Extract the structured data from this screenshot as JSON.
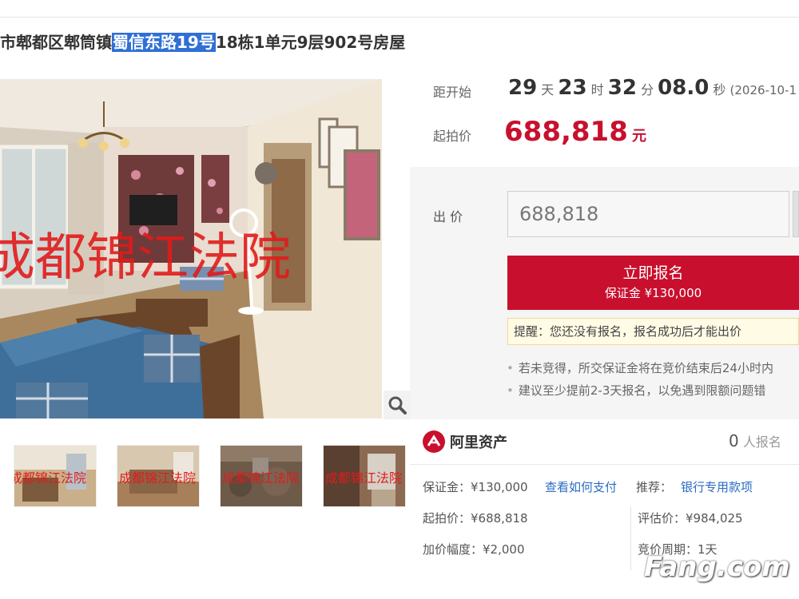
{
  "title": {
    "prefix": "市郫都区郫筒镇",
    "highlight": "蜀信东路19号",
    "suffix": "18栋1单元9层902号房屋"
  },
  "photo": {
    "watermark_text": "成都锦江法院",
    "thumb_watermark_text": "成都锦江法院"
  },
  "countdown": {
    "label": "距开始",
    "days": "29",
    "days_unit": "天",
    "hours": "23",
    "hours_unit": "时",
    "minutes": "32",
    "minutes_unit": "分",
    "seconds": "08.0",
    "seconds_unit": "秒",
    "date": "(2026-10-1"
  },
  "start_price": {
    "label": "起拍价",
    "value": "688,818",
    "unit": "元"
  },
  "bid": {
    "label": "出 价",
    "input_value": "688,818",
    "button_main": "立即报名",
    "button_deposit": "保证金 ¥130,000"
  },
  "reminder": "提醒：您还没有报名，报名成功后才能出价",
  "notes": [
    "若未竞得，所交保证金将在竞价结束后24小时内",
    "建议至少提前2-3天报名，以免遇到限额问题错"
  ],
  "platform": {
    "name": "阿里资产",
    "signup_count": "0",
    "signup_label": "人报名"
  },
  "details": {
    "deposit": "保证金：¥130,000",
    "how_to_pay": "查看如何支付",
    "recommend_label": "推荐：",
    "recommend_link": "银行专用款项",
    "start_price": "起拍价：¥688,818",
    "appraisal": "评估价：¥984,025",
    "increment": "加价幅度：¥2,000",
    "period": "竞价周期：1天"
  },
  "watermark_logo": "Fang.com",
  "colors": {
    "accent_red": "#c8102e",
    "link_blue": "#2b6cc4",
    "highlight_blue": "#2f6fd6"
  }
}
